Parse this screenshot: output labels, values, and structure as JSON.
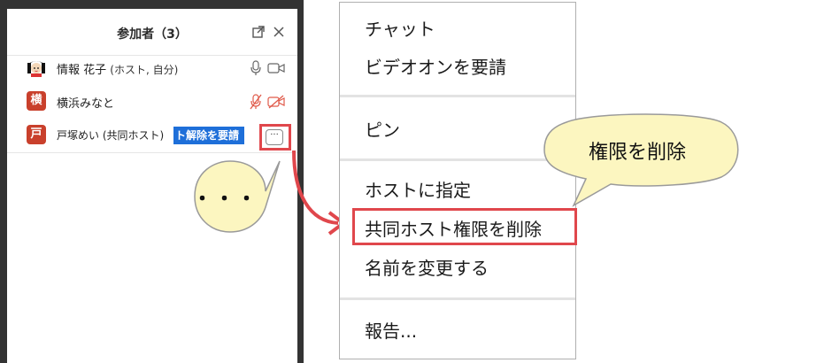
{
  "participants_panel": {
    "title": "参加者（3）",
    "participants": [
      {
        "name": "情報 花子",
        "role": "(ホスト, 自分)"
      },
      {
        "name": "横浜みなと",
        "avatar_char": "横"
      },
      {
        "name": "戸塚めい (共同ホスト)",
        "avatar_char": "戸",
        "hover_action": "ト解除を要請",
        "more_button": "···"
      }
    ]
  },
  "annotations": {
    "dots_bubble": "・・・",
    "callout": "権限を削除"
  },
  "context_menu": {
    "items": [
      "チャット",
      "ビデオオンを要請",
      "ピン",
      "ホストに指定",
      "共同ホスト権限を削除",
      "名前を変更する",
      "報告..."
    ]
  },
  "colors": {
    "highlight_red": "#e0474c",
    "callout_fill": "#fcf6c0",
    "bubble_fill": "#fcf6c0",
    "action_blue": "#1e6fd9",
    "muted_red": "#e05a4a"
  }
}
